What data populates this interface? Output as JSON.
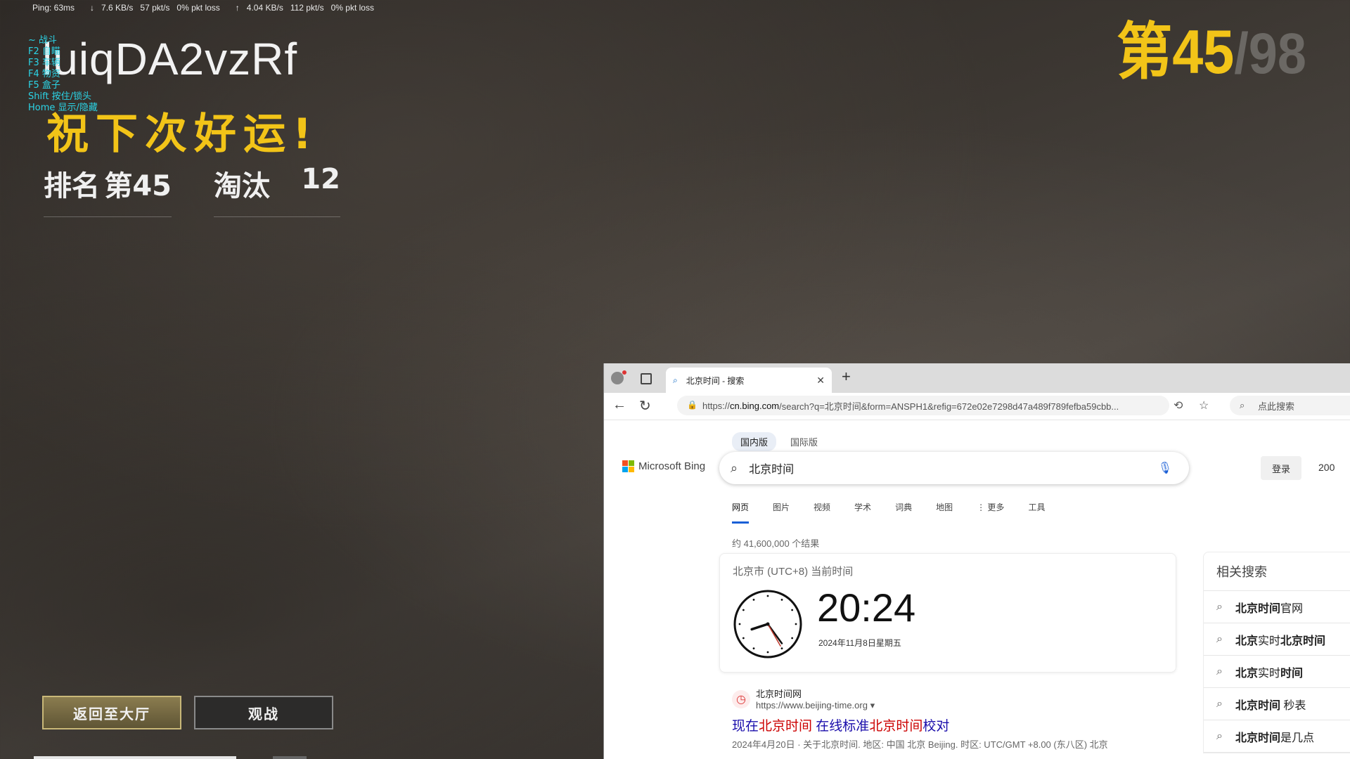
{
  "netstats": {
    "ping": "Ping: 63ms",
    "down_rate": "7.6 KB/s",
    "down_pkts": "57 pkt/s",
    "down_loss": "0% pkt loss",
    "up_rate": "4.04 KB/s",
    "up_pkts": "112 pkt/s",
    "up_loss": "0% pkt loss"
  },
  "player": {
    "name": "luiqDA2vzRf"
  },
  "hotkeys": [
    "~ 战斗",
    "F2 自瞄",
    "F3 车辆",
    "F4 物资",
    "F5 盒子",
    "Shift 按住/锁头",
    "Home 显示/隐藏"
  ],
  "result": {
    "message": "祝下次好运!",
    "rank_label": "排名",
    "rank_value": "第45",
    "kills_label": "淘汰",
    "kills_value": "12",
    "big_rank": "第45",
    "big_total": "/98"
  },
  "buttons": {
    "lobby": "返回至大厅",
    "spectate": "观战"
  },
  "browser": {
    "tab_title": "北京时间 - 搜索",
    "url_prefix": "https://",
    "url_host": "cn.bing.com",
    "url_rest": "/search?q=北京时间&form=ANSPH1&refig=672e02e7298d47a489f789fefba59cbb...",
    "side_search_placeholder": "点此搜索",
    "region_tabs": [
      "国内版",
      "国际版"
    ],
    "logo_text": "Microsoft Bing",
    "query": "北京时间",
    "login": "登录",
    "points": "200",
    "verticals": [
      "网页",
      "图片",
      "视频",
      "学术",
      "词典",
      "地图",
      "⋮ 更多",
      "工具"
    ],
    "result_count": "约 41,600,000 个结果",
    "clock": {
      "label": "北京市 (UTC+8) 当前时间",
      "time": "20:24",
      "date": "2024年11月8日星期五",
      "hour": 20,
      "minute": 24
    },
    "first_result": {
      "site_name": "北京时间网",
      "site_url": "https://www.beijing-time.org ▾",
      "title_parts": [
        "现在",
        "北京时间",
        " 在线标准",
        "北京时间",
        "校对"
      ],
      "snippet": "2024年4月20日 · 关于北京时间. 地区: 中国 北京 Beijing. 时区: UTC/GMT +8.00 (东八区) 北京"
    },
    "related": {
      "heading": "相关搜索",
      "items": [
        {
          "bold": "北京时间",
          "rest": "官网"
        },
        {
          "bold": "北京",
          "rest": "实时",
          "bold2": "北京时间"
        },
        {
          "bold": "北京",
          "rest": "实时",
          "bold2": "时间"
        },
        {
          "bold": "北京时间",
          "rest": " 秒表"
        },
        {
          "bold": "北京时间",
          "rest": "是几点"
        }
      ]
    }
  },
  "colors": {
    "accent_yellow": "#f2c418",
    "hotkey_cyan": "#2bd4e6",
    "bing_blue": "#1a5fd6",
    "link_purple": "#1a0dab"
  }
}
